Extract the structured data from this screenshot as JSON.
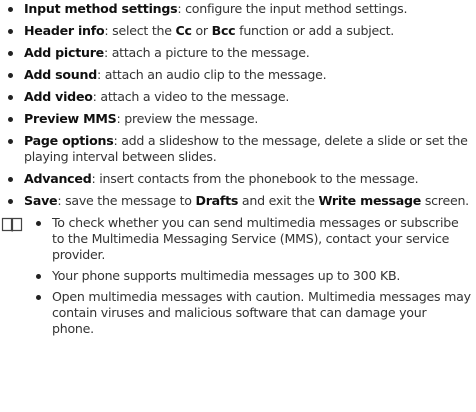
{
  "features": [
    {
      "term": "Input method settings",
      "desc": ": configure the input method settings."
    },
    {
      "term": "Header info",
      "desc_parts": [
        ": select the ",
        "Cc",
        " or ",
        "Bcc",
        " function or add a subject."
      ]
    },
    {
      "term": "Add picture",
      "desc": ": attach a picture to the message."
    },
    {
      "term": "Add sound",
      "desc": ": attach an audio clip to the message."
    },
    {
      "term": "Add video",
      "desc": ": attach a video to the message."
    },
    {
      "term": "Preview MMS",
      "desc": ": preview the message."
    },
    {
      "term": "Page options",
      "desc": ": add a slideshow to the message, delete a slide or set the playing interval between slides."
    },
    {
      "term": "Advanced",
      "desc": ": insert contacts from the phonebook to the message."
    },
    {
      "term": "Save",
      "desc_parts": [
        ": save the message to ",
        "Drafts",
        " and exit the ",
        "Write message",
        " screen."
      ]
    }
  ],
  "note": {
    "icon": "book-note-icon",
    "items": [
      "To check whether you can send multimedia messages or subscribe to the Multimedia Messaging Service (MMS), contact your service provider.",
      "Your phone supports multimedia messages up to 300 KB.",
      "Open multimedia messages with caution. Multimedia messages may contain viruses and malicious software that can damage your phone."
    ]
  }
}
